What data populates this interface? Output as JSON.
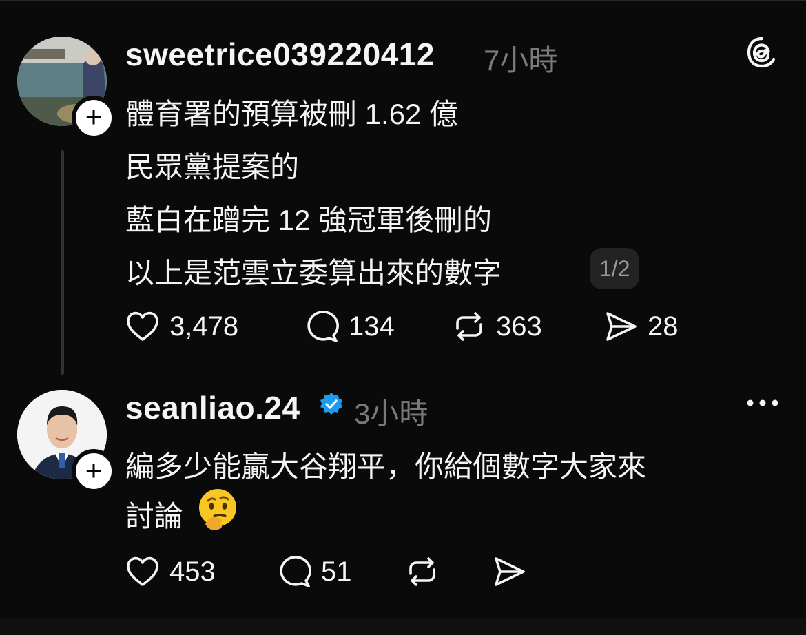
{
  "post": {
    "username": "sweetrice039220412",
    "time": "7小時",
    "lines": [
      "體育署的預算被刪 1.62 億",
      "民眾黨提案的",
      "藍白在蹭完 12 強冠軍後刪的",
      "以上是范雲立委算出來的數字"
    ],
    "page_indicator": "1/2",
    "stats": {
      "likes": "3,478",
      "replies": "134",
      "reposts": "363",
      "shares": "28"
    }
  },
  "reply": {
    "username": "seanliao.24",
    "time": "3小時",
    "lines": [
      "編多少能贏大谷翔平，你給個數字大家來",
      "討論"
    ],
    "stats": {
      "likes": "453",
      "replies": "51"
    }
  },
  "icons": {
    "logo": "threads-logo-icon",
    "like": "heart-icon",
    "reply": "comment-icon",
    "repost": "repost-icon",
    "share": "send-icon",
    "more": "more-icon",
    "verified": "verified-badge-icon",
    "follow": "plus-icon",
    "emoji": "thinking-face-emoji"
  },
  "colors": {
    "background": "#0a0a0a",
    "text": "#f3f5f7",
    "muted": "#7a7a7a",
    "verified": "#1d9bf0"
  }
}
